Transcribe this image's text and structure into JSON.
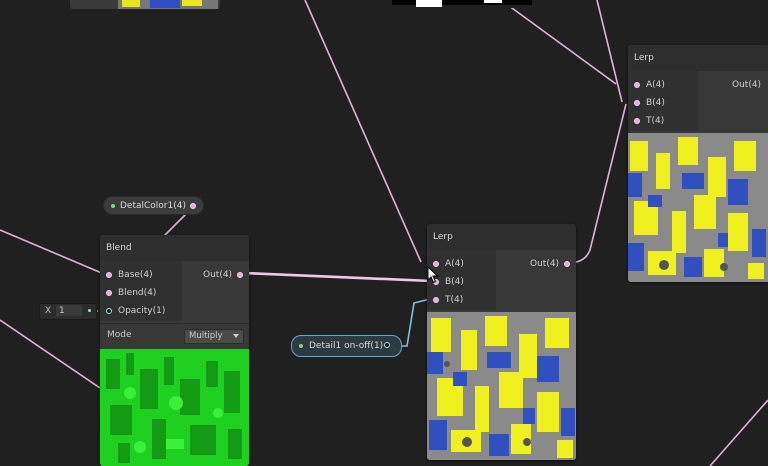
{
  "blend_node": {
    "title": "Blend",
    "inputs": [
      "Base(4)",
      "Blend(4)",
      "Opacity(1)"
    ],
    "output": "Out(4)",
    "mode_label": "Mode",
    "mode_value": "Multiply",
    "opacity_axis": "X",
    "opacity_value": "1"
  },
  "lerp_node_main": {
    "title": "Lerp",
    "inputs": [
      "A(4)",
      "B(4)",
      "T(4)"
    ],
    "output": "Out(4)"
  },
  "lerp_node_right": {
    "title": "Lerp",
    "inputs": [
      "A(4)",
      "B(4)",
      "T(4)"
    ],
    "output": "Out(4)"
  },
  "property_nodes": {
    "detail_color": "DetalColor1(4)",
    "detail_toggle": "Detail1 on-off(1)"
  },
  "colors": {
    "background": "#202020",
    "wire": "#e0b0dc",
    "wire_highlight": "#7ec0e0",
    "node_body": "#383838",
    "node_header": "#2e2e2e",
    "preview_green": "#20d020",
    "preview_yellow": "#f0f020",
    "preview_blue": "#3050c0",
    "preview_gray": "#8a8a8a"
  }
}
